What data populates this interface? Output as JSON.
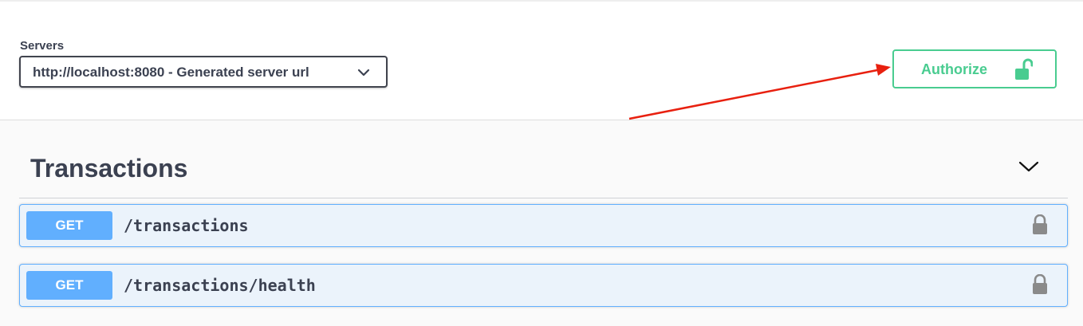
{
  "servers": {
    "label": "Servers",
    "selected": "http://localhost:8080 - Generated server url"
  },
  "authorize": {
    "label": "Authorize",
    "color": "#49cc90"
  },
  "section": {
    "title": "Transactions"
  },
  "operations": [
    {
      "method": "GET",
      "path": "/transactions",
      "method_color": "#61affe"
    },
    {
      "method": "GET",
      "path": "/transactions/health",
      "method_color": "#61affe"
    }
  ],
  "annotation": {
    "arrow_color": "#e8200f"
  }
}
